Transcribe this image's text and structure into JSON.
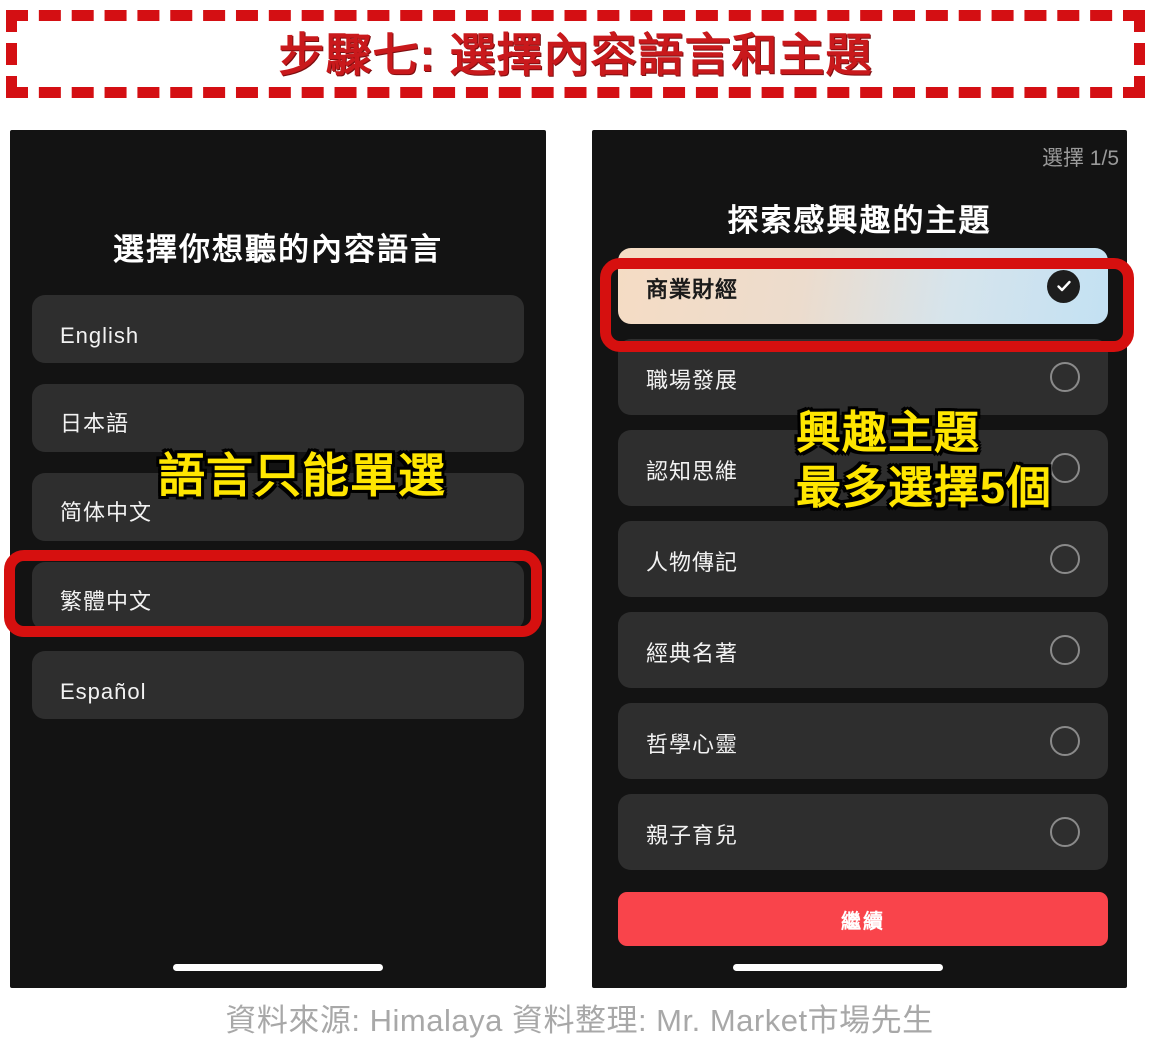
{
  "header": {
    "title": "步驟七:  選擇內容語言和主題",
    "border_color": "#d40f13",
    "text_color": "#c9191c"
  },
  "language_screen": {
    "title": "選擇你想聽的內容語言",
    "items": [
      {
        "label": "English"
      },
      {
        "label": "日本語"
      },
      {
        "label": "简体中文"
      },
      {
        "label": "繁體中文"
      },
      {
        "label": "Español"
      }
    ],
    "highlighted_item_index": 3,
    "annotation": "語言只能單選"
  },
  "topic_screen": {
    "select_count": "選擇 1/5",
    "title": "探索感興趣的主題",
    "items": [
      {
        "label": "商業財經",
        "selected": true
      },
      {
        "label": "職場發展",
        "selected": false
      },
      {
        "label": "認知思維",
        "selected": false
      },
      {
        "label": "人物傳記",
        "selected": false
      },
      {
        "label": "經典名著",
        "selected": false
      },
      {
        "label": "哲學心靈",
        "selected": false
      },
      {
        "label": "親子育兒",
        "selected": false
      }
    ],
    "highlighted_item_index": 0,
    "continue_label": "繼續",
    "continue_color": "#f9444b",
    "annotation_line1": "興趣主題",
    "annotation_line2": "最多選擇5個"
  },
  "footer": {
    "text": "資料來源: Himalaya 資料整理: Mr. Market市場先生"
  },
  "colors": {
    "highlight_red": "#d6100f",
    "annotation_yellow": "#ffe600",
    "phone_bg": "#131313",
    "row_bg": "#2e2e2e"
  }
}
